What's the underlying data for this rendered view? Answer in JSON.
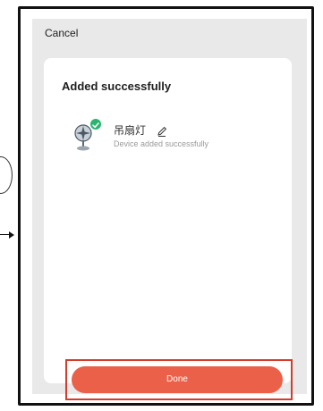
{
  "top_bar": {
    "cancel_label": "Cancel"
  },
  "card": {
    "title": "Added successfully",
    "device": {
      "name": "吊扇灯",
      "status": "Device added successfully",
      "icon": "ceiling-fan-icon",
      "check_icon": "check-badge-icon",
      "edit_icon": "pencil-icon"
    },
    "done_label": "Done"
  },
  "colors": {
    "background": "#e9e9e9",
    "card": "#ffffff",
    "accent": "#ea6048",
    "success": "#2ab56f",
    "highlight": "#d43d2c"
  }
}
